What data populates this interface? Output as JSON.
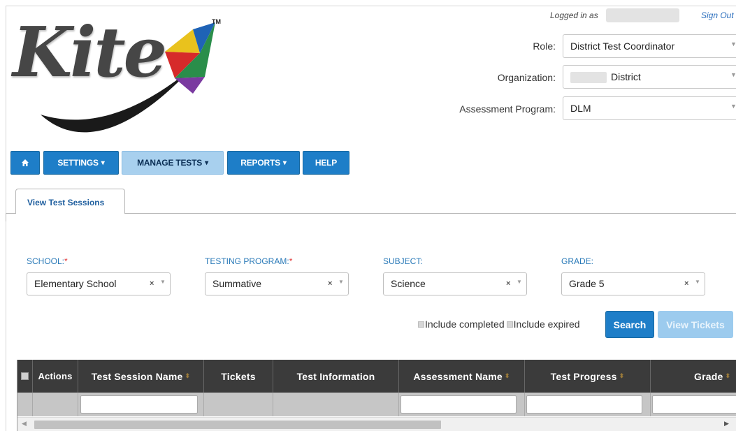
{
  "header": {
    "logo_text": "Kite",
    "logo_tm": "TM",
    "logged_in_label": "Logged in as",
    "sign_out": "Sign Out",
    "role": {
      "label": "Role:",
      "value": "District Test Coordinator"
    },
    "organization": {
      "label": "Organization:",
      "value": "District"
    },
    "assessment_program": {
      "label": "Assessment Program:",
      "value": "DLM"
    }
  },
  "nav": {
    "home_icon": "home-icon",
    "settings": "SETTINGS",
    "manage_tests": "MANAGE TESTS",
    "reports": "REPORTS",
    "help": "HELP"
  },
  "tabs": [
    {
      "label": "View Test Sessions",
      "active": true
    }
  ],
  "filters": {
    "school": {
      "label": "SCHOOL:",
      "required": "*",
      "value": "Elementary School"
    },
    "testing_program": {
      "label": "TESTING PROGRAM:",
      "required": "*",
      "value": "Summative"
    },
    "subject": {
      "label": "SUBJECT:",
      "value": "Science"
    },
    "grade": {
      "label": "GRADE:",
      "value": "Grade 5"
    },
    "clear_glyph": "×",
    "arrow_glyph": "▼"
  },
  "options": {
    "include_completed": "Include completed",
    "include_expired": "Include expired"
  },
  "buttons": {
    "search": "Search",
    "view_tickets": "View Tickets"
  },
  "table": {
    "columns": [
      "Actions",
      "Test Session Name",
      "Tickets",
      "Test Information",
      "Assessment Name",
      "Test Progress",
      "Grade"
    ],
    "sortable_glyph": "⬍"
  },
  "colors": {
    "nav_blue": "#1e7ec8",
    "nav_active": "#a8d0ee",
    "header_dark": "#3b3b3b",
    "label_blue": "#2a7ab8"
  }
}
